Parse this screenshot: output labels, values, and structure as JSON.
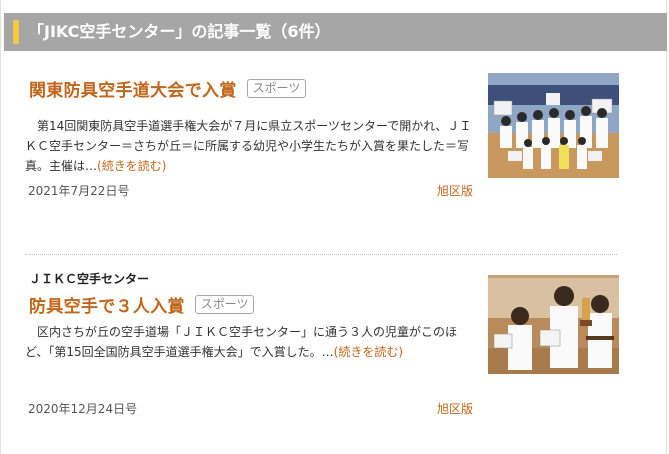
{
  "header": {
    "title": "「JIKC空手センター」の記事一覧（6件）",
    "accent_color": "#f5c842"
  },
  "articles": [
    {
      "kicker": "",
      "title": "関東防具空手道大会で入賞",
      "category": "スポーツ",
      "body": "　第14回関東防具空手道選手権大会が７月に県立スポーツセンターで開かれ、ＪＩＫＣ空手センター＝さちが丘＝に所属する幼児や小学生たちが入賞を果たした＝写真。主催は…",
      "read_more": "(続きを読む)",
      "date": "2021年7月22日号",
      "edition": "旭区版",
      "thumb_icon": "karate-group-photo-icon"
    },
    {
      "kicker": "ＪＩＫＣ空手センター",
      "title": "防具空手で３人入賞",
      "category": "スポーツ",
      "body": "　区内さちが丘の空手道場「ＪＩＫＣ空手センター」に通う３人の児童がこのほど、「第15回全国防具空手道選手権大会」で入賞した。…",
      "read_more": "(続きを読む)",
      "date": "2020年12月24日号",
      "edition": "旭区版",
      "thumb_icon": "karate-trio-photo-icon"
    }
  ],
  "colors": {
    "accent": "#c1661b",
    "header_bg": "#a6a6a6"
  }
}
